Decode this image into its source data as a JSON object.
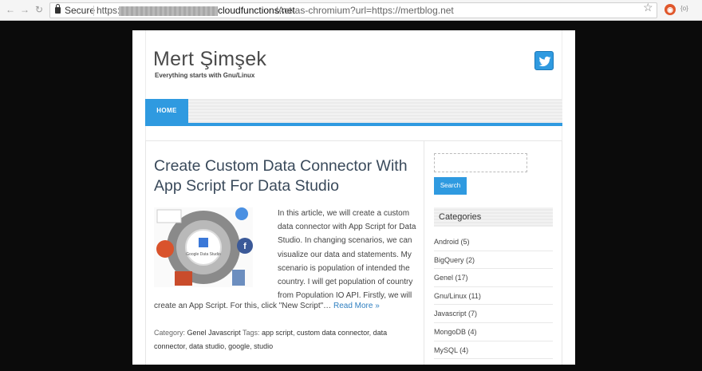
{
  "browser": {
    "secure_label": "Secure",
    "url_scheme": "https://",
    "url_host": "cloudfunctions.net",
    "url_path": "/Act-as-chromium?url=https://mertblog.net",
    "ext_label": "{o}"
  },
  "site": {
    "title": "Mert Şimşek",
    "tagline": "Everything starts with Gnu/Linux",
    "nav": {
      "home": "HOME"
    }
  },
  "post": {
    "title": "Create Custom Data Connector With App Script For Data Studio",
    "excerpt": "In this article, we will create a custom data connector with App Script for Data Studio. In changing scenarios, we can visualize our data and statements. My scenario is population of intended the country. I will get population of country from Population IO API. Firstly, we will",
    "excerpt_tail": "create an App Script. For this, click \"New Script\"…",
    "read_more": "Read More »",
    "thumb_label": "Google Data Studio",
    "meta": {
      "category_label": "Category:",
      "categories": [
        "Genel",
        "Javascript"
      ],
      "tags_label": "Tags:",
      "tags": [
        "app script",
        "custom data connector",
        "data connector",
        "data studio",
        "google",
        "studio"
      ]
    }
  },
  "sidebar": {
    "search_button": "Search",
    "categories_heading": "Categories",
    "categories": [
      {
        "label": "Android (5)"
      },
      {
        "label": "BigQuery (2)"
      },
      {
        "label": "Genel (17)"
      },
      {
        "label": "Gnu/Linux (11)"
      },
      {
        "label": "Javascript (7)"
      },
      {
        "label": "MongoDB (4)"
      },
      {
        "label": "MySQL (4)"
      }
    ]
  },
  "colors": {
    "accent": "#2f9ae0",
    "link": "#2f7fc0"
  }
}
